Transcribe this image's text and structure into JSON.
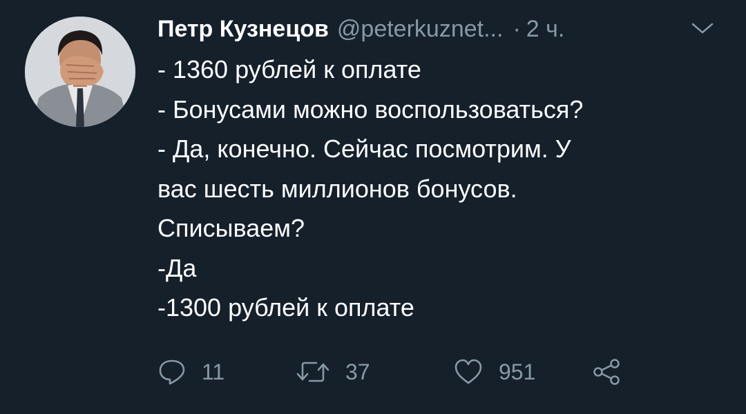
{
  "tweet": {
    "author_name": "Петр Кузнецов",
    "author_handle": "@peterkuznet...",
    "separator": "·",
    "timestamp": "2 ч.",
    "lines": [
      "- 1360 рублей к оплате",
      "- Бонусами можно воспользоваться?",
      "- Да, конечно. Сейчас посмотрим. У",
      "вас шесть миллионов бонусов.",
      "Списываем?",
      "-Да",
      "-1300 рублей к оплате"
    ]
  },
  "actions": {
    "reply_count": "11",
    "retweet_count": "37",
    "like_count": "951"
  },
  "icons": {
    "reply": "reply-icon",
    "retweet": "retweet-icon",
    "like": "heart-icon",
    "share": "share-icon",
    "menu": "chevron-down-icon"
  },
  "colors": {
    "background": "#15202b",
    "text_primary": "#ffffff",
    "text_secondary": "#8899a6"
  }
}
